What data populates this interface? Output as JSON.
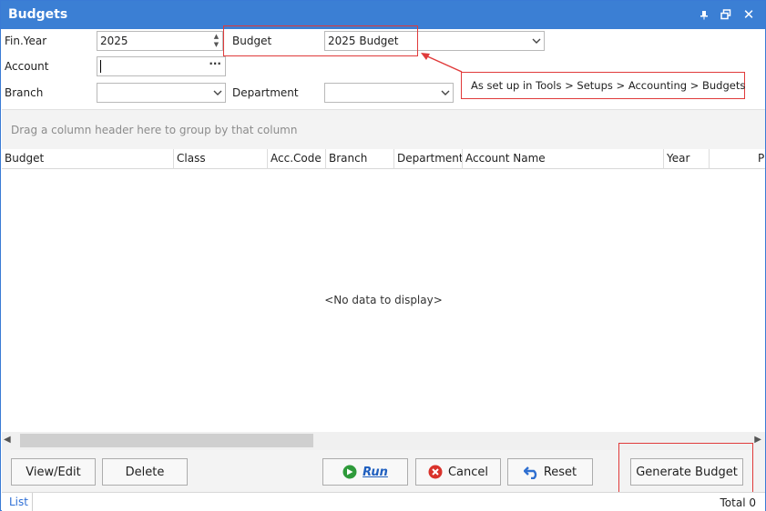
{
  "window": {
    "title": "Budgets"
  },
  "filters": {
    "fin_year_label": "Fin.Year",
    "fin_year_value": "2025",
    "budget_label": "Budget",
    "budget_value": "2025 Budget",
    "account_label": "Account",
    "account_value": "",
    "account_lookup": "···",
    "branch_label": "Branch",
    "branch_value": "",
    "department_label": "Department",
    "department_value": ""
  },
  "callout": {
    "text": "As set up in Tools > Setups > Accounting > Budgets"
  },
  "grid": {
    "group_hint": "Drag a column header here to group by that column",
    "columns": [
      "Budget",
      "Class",
      "Acc.Code",
      "Branch",
      "Department",
      "Account Name",
      "Year",
      "P"
    ],
    "empty_text": "<No data to display>"
  },
  "buttons": {
    "view_edit": "View/Edit",
    "delete": "Delete",
    "run": "Run",
    "cancel": "Cancel",
    "reset": "Reset",
    "generate_budget": "Generate Budget"
  },
  "status": {
    "tab_list": "List",
    "total": "Total 0"
  },
  "colors": {
    "titlebar": "#3b7fd4",
    "annotation": "#e03a3a",
    "run_text": "#1f5fbf",
    "run_icon": "#2e9a3a",
    "cancel_icon": "#d9322b",
    "reset_icon": "#2f6fd0"
  },
  "icons": {
    "pin": "pin-icon",
    "restore": "restore-icon",
    "close": "close-icon",
    "run": "run-arrow-icon",
    "cancel": "cancel-x-icon",
    "reset": "undo-arrow-icon"
  }
}
